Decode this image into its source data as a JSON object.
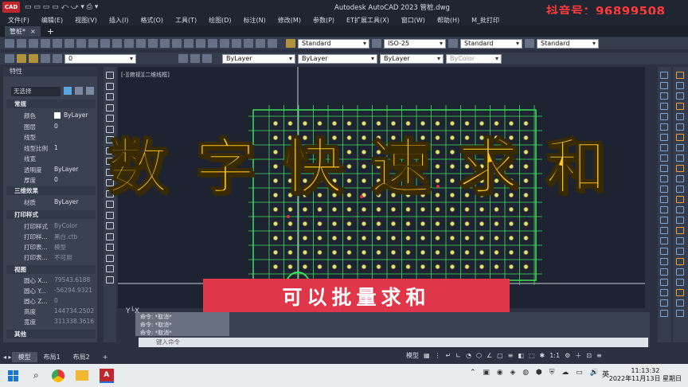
{
  "titlebar": {
    "app_logo": "CAD",
    "title": "Autodesk AutoCAD 2023   管桩.dwg",
    "watermark": "抖音号：96899508"
  },
  "menus": [
    "文件(F)",
    "编辑(E)",
    "视图(V)",
    "插入(I)",
    "格式(O)",
    "工具(T)",
    "绘图(D)",
    "标注(N)",
    "修改(M)",
    "参数(P)",
    "ET扩展工具(X)",
    "窗口(W)",
    "帮助(H)",
    "M_批打印"
  ],
  "tabs": {
    "file_tab": "管桩*",
    "file_tab_close": "×",
    "add": "+"
  },
  "toolbar": {
    "text_style": "Standard",
    "dim_style": "ISO-25",
    "table_style": "Standard",
    "multileader_style": "Standard",
    "layer": "0",
    "color": "ByLayer",
    "linetype": "ByLayer",
    "lineweight": "ByLayer",
    "plot_style": "ByColor"
  },
  "properties": {
    "title": "特性",
    "selection": "无选择",
    "sections": {
      "general": "常规",
      "3d": "三维效果",
      "plot": "打印样式",
      "view": "视图",
      "misc": "其他"
    },
    "general": [
      {
        "label": "颜色",
        "value": "ByLayer"
      },
      {
        "label": "图层",
        "value": "0"
      },
      {
        "label": "线型",
        "value": ""
      },
      {
        "label": "线型比例",
        "value": "1"
      },
      {
        "label": "线宽",
        "value": ""
      },
      {
        "label": "透明度",
        "value": "ByLayer"
      },
      {
        "label": "厚度",
        "value": "0"
      }
    ],
    "material": {
      "label": "材质",
      "value": "ByLayer"
    },
    "plot": [
      {
        "label": "打印样式",
        "value": "ByColor"
      },
      {
        "label": "打印样...",
        "value": "黑白.ctb"
      },
      {
        "label": "打印表...",
        "value": "模型"
      },
      {
        "label": "打印表...",
        "value": "不可用"
      }
    ],
    "view": [
      {
        "label": "圆心 X...",
        "value": "79543.6188"
      },
      {
        "label": "圆心 Y...",
        "value": "-56294.9321"
      },
      {
        "label": "圆心 Z...",
        "value": "0"
      },
      {
        "label": "高度",
        "value": "144734.2502"
      },
      {
        "label": "宽度",
        "value": "311338.3616"
      }
    ]
  },
  "canvas": {
    "view_label": "[-][俯视][二维线框]"
  },
  "overlay": {
    "headline": [
      "数",
      "字",
      "快",
      "速",
      "求",
      "和"
    ],
    "subtitle": "可以批量求和"
  },
  "command": {
    "history": [
      "命令: *取消*",
      "命令: *取消*",
      "命令: *取消*"
    ],
    "placeholder": "键入命令"
  },
  "layout_tabs": [
    "模型",
    "布局1",
    "布局2"
  ],
  "status": {
    "model": "模型",
    "scale": "1:1"
  },
  "taskbar": {
    "time": "11:13:32",
    "date": "2022年11月13日 星期日",
    "ime": "英"
  },
  "colors": {
    "accent": "#f7c624",
    "banner": "#e0364a",
    "watermark": "#ff3a3a",
    "grid": "#3ee05a"
  }
}
